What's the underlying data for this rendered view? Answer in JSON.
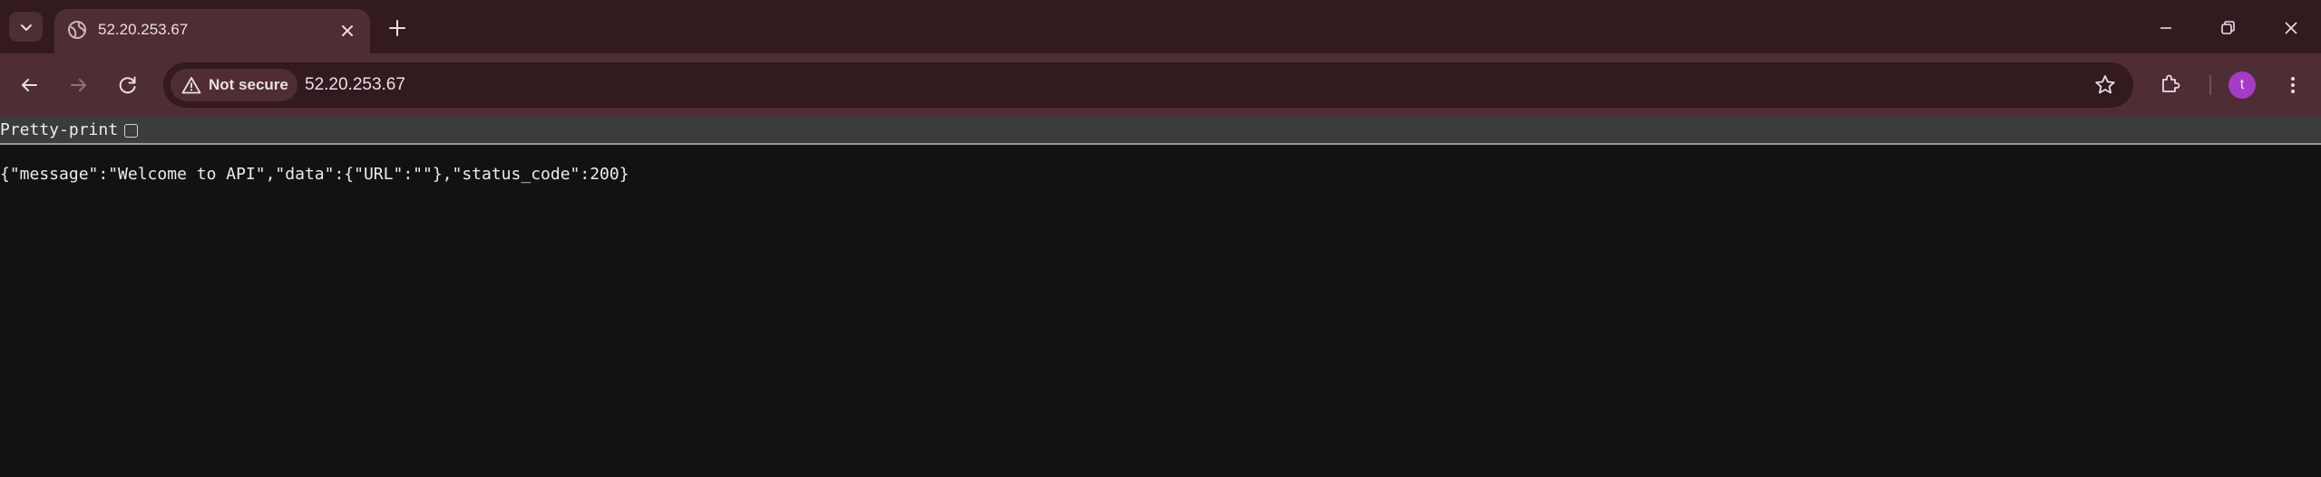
{
  "browser": {
    "tab": {
      "title": "52.20.253.67"
    },
    "address_bar": {
      "security_label": "Not secure",
      "url": "52.20.253.67"
    },
    "profile_initial": "t",
    "icons": [
      "tab-search-icon",
      "globe-icon",
      "close-icon",
      "plus-icon",
      "minimize-icon",
      "restore-icon",
      "window-close-icon",
      "back-arrow-icon",
      "forward-arrow-icon",
      "reload-icon",
      "warning-icon",
      "star-icon",
      "extensions-icon",
      "kebab-menu-icon"
    ],
    "colors": {
      "frame": "#321a1f",
      "toolbar": "#4e2d34",
      "avatar": "#a53cc6"
    }
  },
  "page": {
    "pretty_print_label": "Pretty-print",
    "pretty_print_checked": false,
    "json_text": "{\"message\":\"Welcome to API\",\"data\":{\"URL\":\"\"},\"status_code\":200}"
  }
}
